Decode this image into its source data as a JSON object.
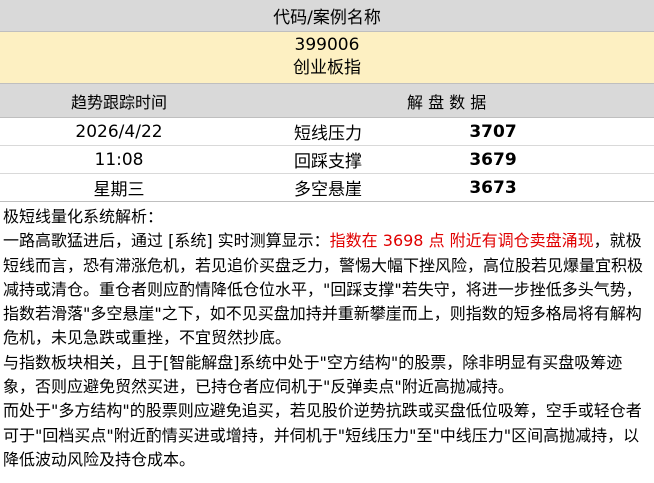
{
  "header": {
    "title": "代码/案例名称"
  },
  "instrument": {
    "code": "399006",
    "name": "创业板指"
  },
  "columns": {
    "trend_time": "趋势跟踪时间",
    "data": "解 盘 数 据"
  },
  "rows": [
    {
      "time": "2026/4/22",
      "label": "短线压力",
      "value": "3707"
    },
    {
      "time": "11:08",
      "label": "回踩支撑",
      "value": "3679"
    },
    {
      "time": "星期三",
      "label": "多空悬崖",
      "value": "3673"
    }
  ],
  "analysis": {
    "title": "极短线量化系统解析：",
    "p1_prefix": "一路高歌猛进后，通过 [系统] 实时测算显示：",
    "p1_red": "指数在 3698 点 附近有调仓卖盘涌现",
    "p1_rest": "，就极短线而言，恐有滞涨危机，若见追价买盘乏力，警惕大幅下挫风险，高位股若见爆量宜积极减持或清仓。重仓者则应酌情降低仓位水平，\"回踩支撑\"若失守，将进一步挫低多头气势，指数若滑落\"多空悬崖\"之下，如不见买盘加持并重新攀崖而上，则指数的短多格局将有解构危机，未见急跌或重挫，不宜贸然抄底。",
    "p2": "与指数板块相关，且于[智能解盘]系统中处于\"空方结构\"的股票，除非明显有买盘吸筹迹象，否则应避免贸然买进，已持仓者应伺机于\"反弹卖点\"附近高抛减持。",
    "p3": "而处于\"多方结构\"的股票则应避免追买，若见股价逆势抗跌或买盘低位吸筹，空手或轻仓者可于\"回档买点\"附近酌情买进或增持，并伺机于\"短线压力\"至\"中线压力\"区间高抛减持，以降低波动风险及持仓成本。"
  },
  "colors": {
    "header_bg": "#d9d9d9",
    "highlight_bg": "#fdf0c2",
    "alert_text": "#e00000"
  }
}
